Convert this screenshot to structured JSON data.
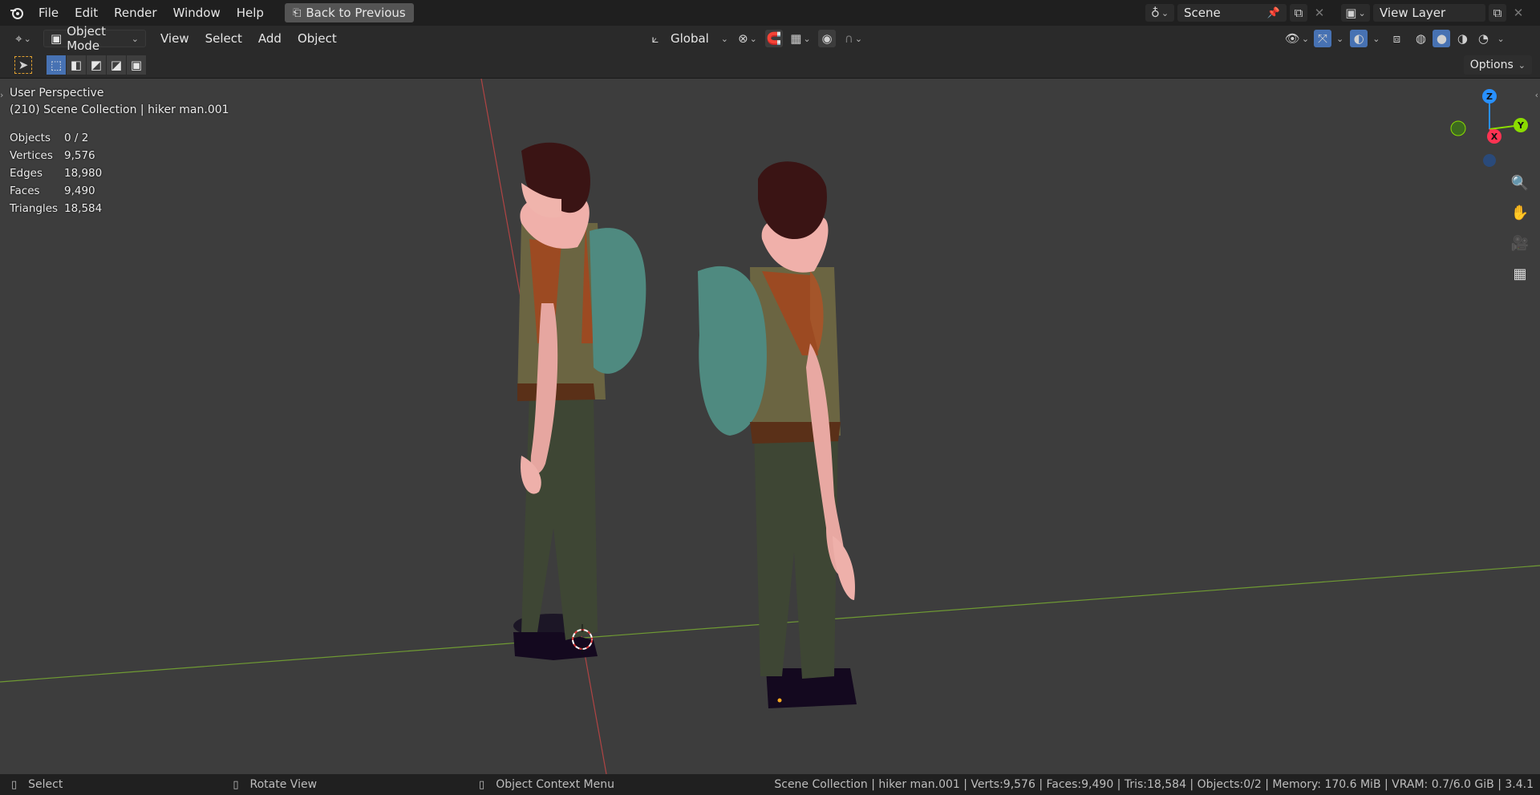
{
  "topbar": {
    "menus": [
      "File",
      "Edit",
      "Render",
      "Window",
      "Help"
    ],
    "back_button": "Back to Previous",
    "scene_name": "Scene",
    "view_layer": "View Layer"
  },
  "header": {
    "mode": "Object Mode",
    "menus": [
      "View",
      "Select",
      "Add",
      "Object"
    ],
    "orientation": "Global"
  },
  "toolbar": {
    "options_label": "Options"
  },
  "viewport": {
    "perspective": "User Perspective",
    "collection": "(210) Scene Collection | hiker man.001",
    "stats": [
      {
        "label": "Objects",
        "value": "0 / 2"
      },
      {
        "label": "Vertices",
        "value": "9,576"
      },
      {
        "label": "Edges",
        "value": "18,980"
      },
      {
        "label": "Faces",
        "value": "9,490"
      },
      {
        "label": "Triangles",
        "value": "18,584"
      }
    ],
    "gizmo": {
      "z": "Z",
      "y": "Y",
      "x": "X"
    }
  },
  "statusbar": {
    "left_hint": "Select",
    "middle_hint": "Rotate View",
    "right_hint": "Object Context Menu",
    "info": "Scene Collection | hiker man.001 | Verts:9,576 | Faces:9,490 | Tris:18,584 | Objects:0/2 | Memory: 170.6 MiB | VRAM: 0.7/6.0 GiB | 3.4.1"
  },
  "colors": {
    "accent": "#4772b3",
    "x_axis": "#ff3352",
    "y_axis": "#8bdc00",
    "z_axis": "#2890ff"
  }
}
